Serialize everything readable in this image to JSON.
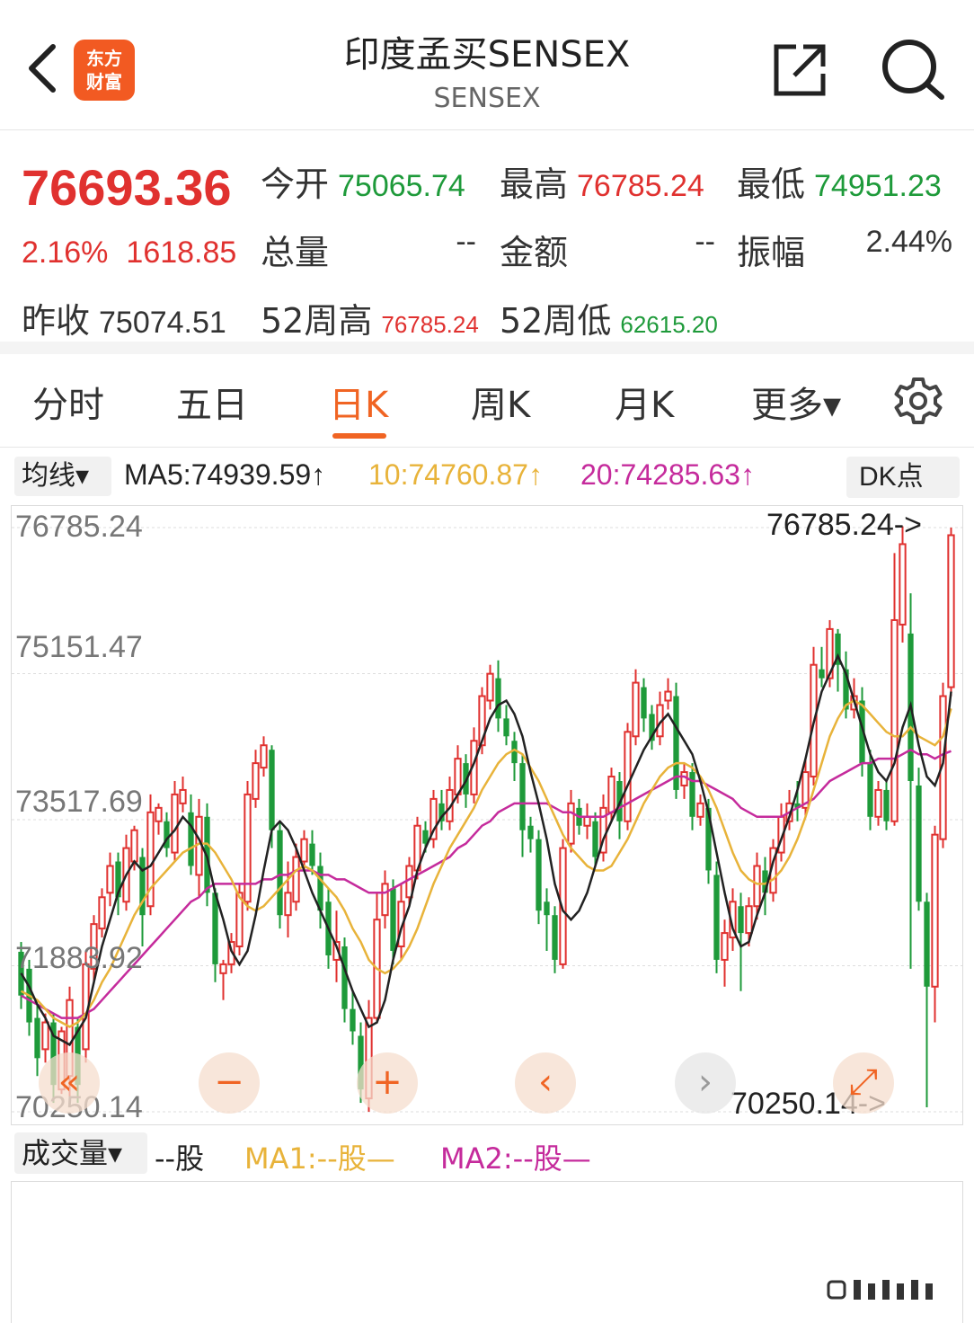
{
  "header": {
    "title": "印度孟买SENSEX",
    "subtitle": "SENSEX",
    "logo_line1": "东方",
    "logo_line2": "财富"
  },
  "quote": {
    "price": "76693.36",
    "change_pct": "2.16%",
    "change_amt": "1618.85",
    "open_label": "今开",
    "open": "75065.74",
    "high_label": "最高",
    "high": "76785.24",
    "low_label": "最低",
    "low": "74951.23",
    "volume_label": "总量",
    "volume": "--",
    "amount_label": "金额",
    "amount": "--",
    "amplitude_label": "振幅",
    "amplitude": "2.44%",
    "prev_close_label": "昨收",
    "prev_close": "75074.51",
    "week52_high_label": "52周高",
    "week52_high": "76785.24",
    "week52_low_label": "52周低",
    "week52_low": "62615.20"
  },
  "tabs": [
    {
      "label": "分时"
    },
    {
      "label": "五日"
    },
    {
      "label": "日K"
    },
    {
      "label": "周K"
    },
    {
      "label": "月K"
    },
    {
      "label": "更多▾"
    }
  ],
  "ma": {
    "selector": "均线▾",
    "ma5": "MA5:74939.59↑",
    "ma10": "10:74760.87↑",
    "ma20": "20:74285.63↑",
    "dk_button": "DK点"
  },
  "chart_data": {
    "type": "candlestick",
    "y_ticks": [
      "76785.24",
      "75151.47",
      "73517.69",
      "71883.92",
      "70250.14"
    ],
    "ylim": [
      70250.14,
      76785.24
    ],
    "max_label": "76785.24->",
    "min_label": "70250.14->",
    "colors": {
      "up": "#e0312f",
      "down": "#1e9a3a",
      "ma5": "#222222",
      "ma10": "#e8b33a",
      "ma20": "#c52b9c"
    },
    "candles": [
      [
        72040,
        71550,
        72150,
        71400
      ],
      [
        71850,
        71250,
        71950,
        71100
      ],
      [
        71300,
        70850,
        71450,
        70650
      ],
      [
        70950,
        71250,
        71350,
        70800
      ],
      [
        71250,
        70550,
        71350,
        70350
      ],
      [
        70500,
        71150,
        71200,
        70450
      ],
      [
        70650,
        71500,
        71650,
        70350
      ],
      [
        71200,
        70550,
        71300,
        70350
      ],
      [
        70950,
        71900,
        72050,
        70800
      ],
      [
        71850,
        72350,
        72450,
        71700
      ],
      [
        72300,
        72650,
        72750,
        72200
      ],
      [
        72700,
        73000,
        73150,
        72550
      ],
      [
        73050,
        72650,
        73150,
        72450
      ],
      [
        72600,
        73200,
        73350,
        72500
      ],
      [
        73050,
        73400,
        73450,
        72950
      ],
      [
        73100,
        72450,
        73200,
        72100
      ],
      [
        72550,
        73600,
        73800,
        72450
      ],
      [
        73500,
        73650,
        73700,
        73350
      ],
      [
        73500,
        73200,
        73600,
        73100
      ],
      [
        73150,
        73800,
        73950,
        73050
      ],
      [
        73700,
        73850,
        74000,
        73600
      ],
      [
        73600,
        73000,
        73800,
        72900
      ],
      [
        72900,
        73550,
        73750,
        72650
      ],
      [
        73550,
        72700,
        73700,
        72550
      ],
      [
        72700,
        71900,
        72750,
        71700
      ],
      [
        71800,
        71900,
        71950,
        71500
      ],
      [
        71900,
        72150,
        72250,
        71800
      ],
      [
        72100,
        72700,
        72800,
        72000
      ],
      [
        72600,
        73800,
        73950,
        72500
      ],
      [
        73750,
        74150,
        74300,
        73650
      ],
      [
        74100,
        74350,
        74450,
        74000
      ],
      [
        74300,
        73400,
        74350,
        73200
      ],
      [
        73400,
        72450,
        73500,
        72300
      ],
      [
        72450,
        72700,
        73050,
        72200
      ],
      [
        72600,
        73100,
        73250,
        72500
      ],
      [
        73050,
        73300,
        73400,
        72950
      ],
      [
        73250,
        73000,
        73400,
        72900
      ],
      [
        73000,
        72500,
        73150,
        72300
      ],
      [
        72600,
        72000,
        72750,
        71850
      ],
      [
        71950,
        72150,
        72500,
        71700
      ],
      [
        72100,
        71400,
        72200,
        71250
      ],
      [
        71400,
        71150,
        71600,
        71000
      ],
      [
        71100,
        70500,
        71250,
        70350
      ],
      [
        70400,
        71300,
        71500,
        70250
      ],
      [
        71300,
        72400,
        72700,
        71250
      ],
      [
        72450,
        72800,
        72950,
        72300
      ],
      [
        72750,
        72050,
        72850,
        71900
      ],
      [
        72100,
        72600,
        72800,
        71950
      ],
      [
        72650,
        73000,
        73100,
        72550
      ],
      [
        72950,
        73450,
        73550,
        72850
      ],
      [
        73400,
        73250,
        73500,
        73150
      ],
      [
        73300,
        73750,
        73850,
        73200
      ],
      [
        73700,
        73500,
        73850,
        73400
      ],
      [
        73500,
        73850,
        74000,
        73400
      ],
      [
        73800,
        74200,
        74350,
        73700
      ],
      [
        74150,
        73800,
        74250,
        73650
      ],
      [
        73800,
        74400,
        74550,
        73700
      ],
      [
        74350,
        74900,
        75000,
        74250
      ],
      [
        74850,
        75150,
        75250,
        74750
      ],
      [
        75100,
        74650,
        75300,
        74500
      ],
      [
        74650,
        74450,
        74800,
        74350
      ],
      [
        74400,
        74150,
        74500,
        73950
      ],
      [
        74150,
        73400,
        74250,
        73100
      ],
      [
        73450,
        73300,
        73550,
        73150
      ],
      [
        73300,
        72500,
        73400,
        72350
      ],
      [
        72600,
        72450,
        72750,
        72050
      ],
      [
        72450,
        71950,
        72550,
        71800
      ],
      [
        71900,
        73200,
        73300,
        71850
      ],
      [
        73250,
        73700,
        73850,
        73150
      ],
      [
        73650,
        73450,
        73750,
        73350
      ],
      [
        73450,
        73550,
        73700,
        73300
      ],
      [
        73500,
        73100,
        73600,
        73000
      ],
      [
        73150,
        73650,
        73800,
        73050
      ],
      [
        73600,
        74000,
        74100,
        73500
      ],
      [
        73950,
        73500,
        74050,
        73300
      ],
      [
        73500,
        74500,
        74600,
        73400
      ],
      [
        74450,
        75050,
        75200,
        74350
      ],
      [
        75000,
        74650,
        75100,
        74500
      ],
      [
        74700,
        74400,
        74800,
        74300
      ],
      [
        74450,
        74800,
        74950,
        74350
      ],
      [
        74850,
        74950,
        75100,
        74750
      ],
      [
        74900,
        73850,
        75050,
        73750
      ],
      [
        73900,
        74050,
        74150,
        73750
      ],
      [
        74050,
        73550,
        74150,
        73400
      ],
      [
        73550,
        73700,
        73800,
        73450
      ],
      [
        73650,
        72950,
        73750,
        72800
      ],
      [
        72900,
        71950,
        73050,
        71800
      ],
      [
        71950,
        72250,
        72400,
        71650
      ],
      [
        72200,
        72600,
        72750,
        72050
      ],
      [
        72550,
        72250,
        72700,
        71600
      ],
      [
        72250,
        72550,
        72650,
        72100
      ],
      [
        72550,
        73000,
        73150,
        72400
      ],
      [
        72950,
        72700,
        73100,
        72450
      ],
      [
        72700,
        73200,
        73300,
        72600
      ],
      [
        73150,
        73550,
        73700,
        73050
      ],
      [
        73500,
        73700,
        73850,
        73400
      ],
      [
        73700,
        73650,
        73950,
        73500
      ],
      [
        73650,
        74050,
        74200,
        73550
      ],
      [
        74000,
        75250,
        75450,
        73900
      ],
      [
        75200,
        75100,
        75450,
        75000
      ],
      [
        75100,
        75650,
        75750,
        75000
      ],
      [
        75600,
        75250,
        75650,
        74950
      ],
      [
        75200,
        74750,
        75400,
        74650
      ],
      [
        74750,
        74900,
        75100,
        74650
      ],
      [
        74850,
        74150,
        75000,
        74000
      ],
      [
        74150,
        73550,
        74300,
        73400
      ],
      [
        73550,
        73850,
        73950,
        73450
      ],
      [
        73850,
        73500,
        73950,
        73400
      ],
      [
        73500,
        75750,
        76500,
        73450
      ],
      [
        75700,
        76600,
        76800,
        75500
      ],
      [
        75600,
        73950,
        76050,
        71850
      ],
      [
        73900,
        72600,
        74100,
        72500
      ],
      [
        72600,
        71650,
        72700,
        70300
      ],
      [
        71650,
        73350,
        73450,
        71250
      ],
      [
        73300,
        74900,
        75050,
        73200
      ],
      [
        75000,
        76700,
        76785,
        74900
      ]
    ],
    "ma5": [
      71800,
      71650,
      71450,
      71300,
      71100,
      71050,
      71000,
      71150,
      71300,
      71700,
      72100,
      72400,
      72700,
      72900,
      73050,
      72950,
      73000,
      73150,
      73300,
      73400,
      73550,
      73450,
      73300,
      73100,
      72700,
      72400,
      72050,
      71900,
      72050,
      72450,
      72950,
      73400,
      73500,
      73400,
      73200,
      72950,
      72700,
      72500,
      72300,
      72100,
      71850,
      71600,
      71400,
      71200,
      71250,
      71500,
      71950,
      72300,
      72550,
      72950,
      73200,
      73400,
      73550,
      73650,
      73800,
      73950,
      74150,
      74400,
      74650,
      74800,
      74850,
      74700,
      74450,
      74050,
      73700,
      73300,
      72800,
      72500,
      72400,
      72500,
      72700,
      73000,
      73300,
      73500,
      73700,
      73900,
      74100,
      74300,
      74450,
      74600,
      74700,
      74550,
      74400,
      74250,
      73950,
      73600,
      73150,
      72700,
      72300,
      72100,
      72150,
      72450,
      72700,
      73050,
      73300,
      73550,
      73850,
      74200,
      74600,
      74950,
      75150,
      75350,
      75150,
      74850,
      74550,
      74250,
      74050,
      73950,
      74150,
      74550,
      74800,
      74350,
      74000,
      73900,
      74150,
      74950
    ],
    "ma10": [
      71600,
      71550,
      71500,
      71400,
      71300,
      71250,
      71200,
      71250,
      71350,
      71500,
      71700,
      71850,
      72050,
      72250,
      72450,
      72600,
      72750,
      72850,
      72950,
      73050,
      73150,
      73200,
      73250,
      73250,
      73150,
      73000,
      72850,
      72650,
      72550,
      72500,
      72550,
      72650,
      72750,
      72850,
      72950,
      73000,
      72950,
      72850,
      72750,
      72650,
      72500,
      72300,
      72150,
      71950,
      71850,
      71800,
      71850,
      71950,
      72100,
      72300,
      72550,
      72800,
      73000,
      73200,
      73350,
      73500,
      73650,
      73850,
      74000,
      74150,
      74250,
      74300,
      74250,
      74100,
      73950,
      73750,
      73550,
      73350,
      73200,
      73100,
      73000,
      72950,
      72950,
      73000,
      73150,
      73300,
      73500,
      73700,
      73850,
      74000,
      74100,
      74150,
      74150,
      74100,
      74000,
      73850,
      73650,
      73400,
      73150,
      72950,
      72850,
      72800,
      72800,
      72850,
      72950,
      73100,
      73300,
      73550,
      73850,
      74150,
      74450,
      74650,
      74800,
      74850,
      74800,
      74700,
      74600,
      74500,
      74450,
      74450,
      74550,
      74450,
      74400,
      74350,
      74450,
      74760
    ],
    "ma20": [
      71550,
      71500,
      71450,
      71400,
      71350,
      71300,
      71300,
      71300,
      71350,
      71400,
      71500,
      71600,
      71700,
      71800,
      71900,
      72000,
      72100,
      72200,
      72300,
      72400,
      72500,
      72600,
      72650,
      72750,
      72800,
      72800,
      72800,
      72800,
      72800,
      72800,
      72850,
      72850,
      72900,
      72900,
      72950,
      72950,
      72950,
      72900,
      72900,
      72850,
      72850,
      72800,
      72750,
      72700,
      72700,
      72700,
      72750,
      72800,
      72850,
      72900,
      72950,
      73000,
      73050,
      73100,
      73200,
      73250,
      73350,
      73450,
      73500,
      73600,
      73650,
      73700,
      73700,
      73700,
      73700,
      73700,
      73650,
      73600,
      73600,
      73550,
      73550,
      73550,
      73550,
      73600,
      73650,
      73700,
      73750,
      73800,
      73850,
      73900,
      73950,
      74000,
      74000,
      73950,
      73950,
      73900,
      73850,
      73800,
      73750,
      73650,
      73600,
      73550,
      73550,
      73550,
      73550,
      73600,
      73650,
      73700,
      73750,
      73850,
      73950,
      74000,
      74050,
      74100,
      74150,
      74150,
      74200,
      74200,
      74200,
      74250,
      74300,
      74250,
      74250,
      74200,
      74250,
      74285
    ]
  },
  "controls": {
    "rewind": "«",
    "zoom_out": "−",
    "zoom_in": "+",
    "prev": "‹",
    "next": "›",
    "fullscreen": "⤢"
  },
  "volume": {
    "selector": "成交量▾",
    "value": "--股",
    "ma1": "MA1:--股—",
    "ma2": "MA2:--股—"
  }
}
